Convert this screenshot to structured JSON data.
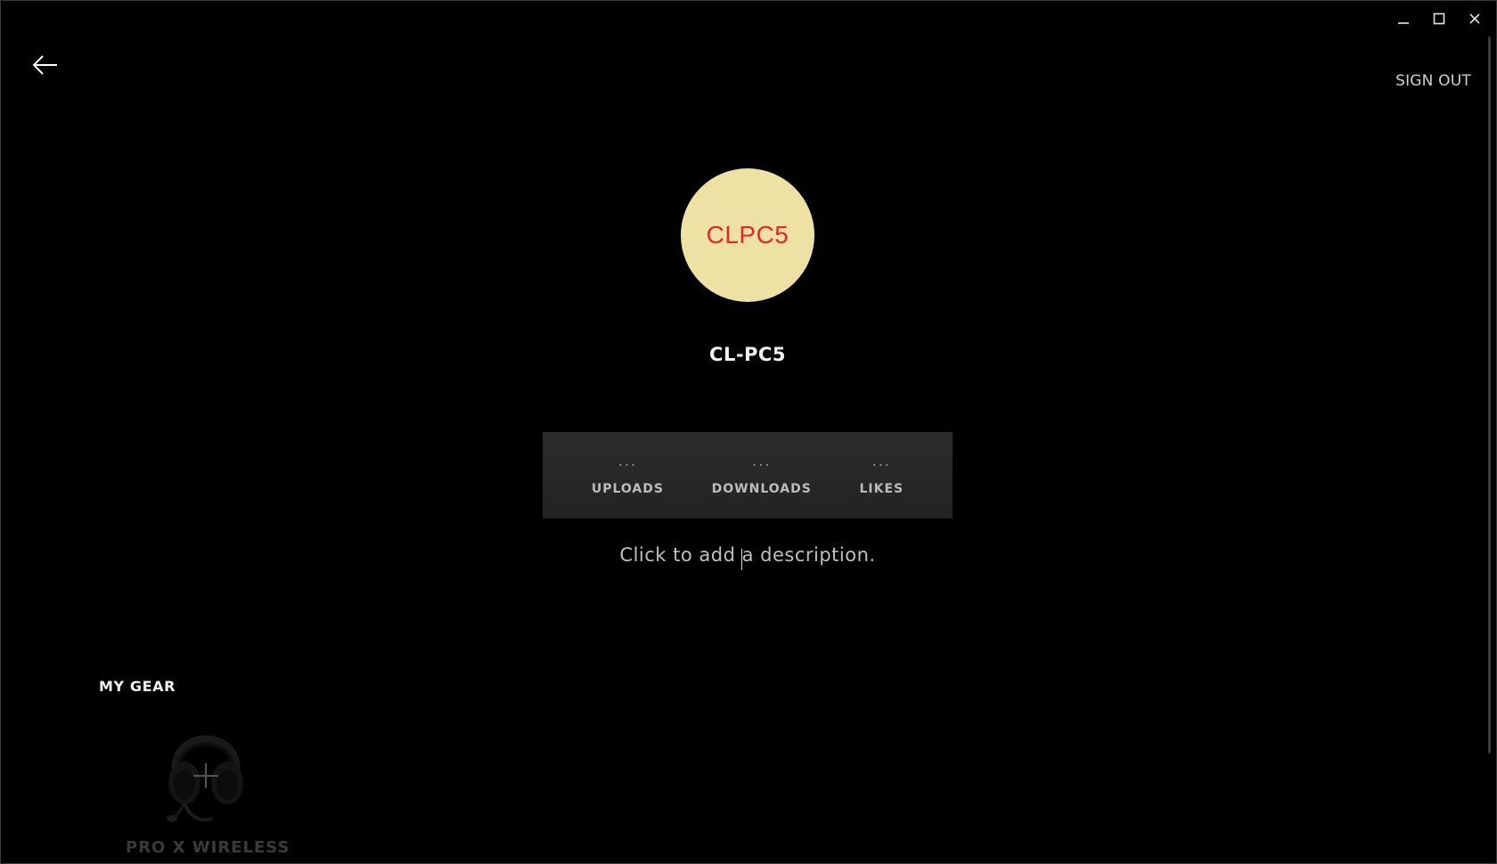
{
  "window": {
    "controls": [
      "minimize-icon",
      "maximize-icon",
      "close-icon"
    ]
  },
  "header": {
    "back_icon": "arrow-left-icon",
    "sign_out_label": "SIGN OUT"
  },
  "profile": {
    "avatar_text": "CLPC5",
    "avatar_bg_color": "#ede2a4",
    "avatar_text_color": "#e8242a",
    "username": "CL-PC5",
    "description_placeholder_before": "Click to add ",
    "description_placeholder_after": " description."
  },
  "stats": [
    {
      "value": "...",
      "label": "UPLOADS"
    },
    {
      "value": "...",
      "label": "DOWNLOADS"
    },
    {
      "value": "...",
      "label": "LIKES"
    }
  ],
  "gear": {
    "title": "MY GEAR",
    "items": [
      {
        "name": "PRO X WIRELESS",
        "icon": "headset-icon",
        "overlay_icon": "plus-icon"
      }
    ]
  }
}
